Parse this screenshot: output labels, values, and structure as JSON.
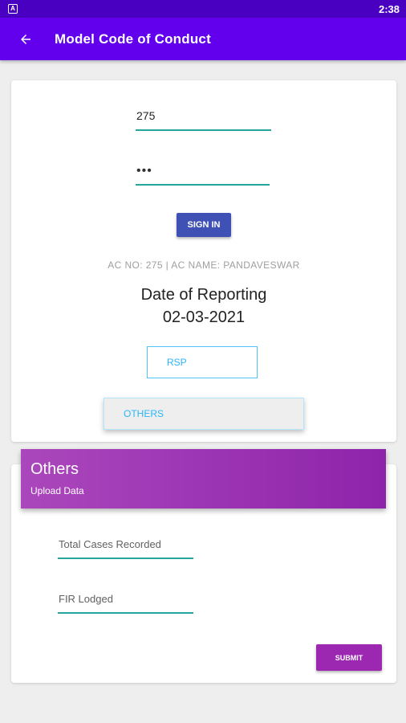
{
  "status_bar": {
    "app_icon_letter": "A",
    "time": "2:38"
  },
  "app_bar": {
    "title": "Model Code of Conduct",
    "back_icon": "arrow-back-icon"
  },
  "login": {
    "username_value": "275",
    "password_value": "•••",
    "sign_in_label": "SIGN IN"
  },
  "info": {
    "ac_text": "AC NO: 275 | AC NAME: PANDAVESWAR",
    "date_label": "Date of Reporting",
    "date_value": "02-03-2021"
  },
  "buttons": {
    "rsp": "RSP",
    "others": "OTHERS"
  },
  "others_section": {
    "title": "Others",
    "subtitle": "Upload Data",
    "fields": {
      "total_cases_placeholder": "Total Cases Recorded",
      "fir_placeholder": "FIR Lodged"
    },
    "submit_label": "SUBMIT"
  },
  "colors": {
    "status_bar": "#4a00c0",
    "app_bar": "#6200ee",
    "sign_in": "#3f51b5",
    "input_underline": "#26a69a",
    "accent_blue": "#29b6f6",
    "others_header": "#9c27b0"
  }
}
